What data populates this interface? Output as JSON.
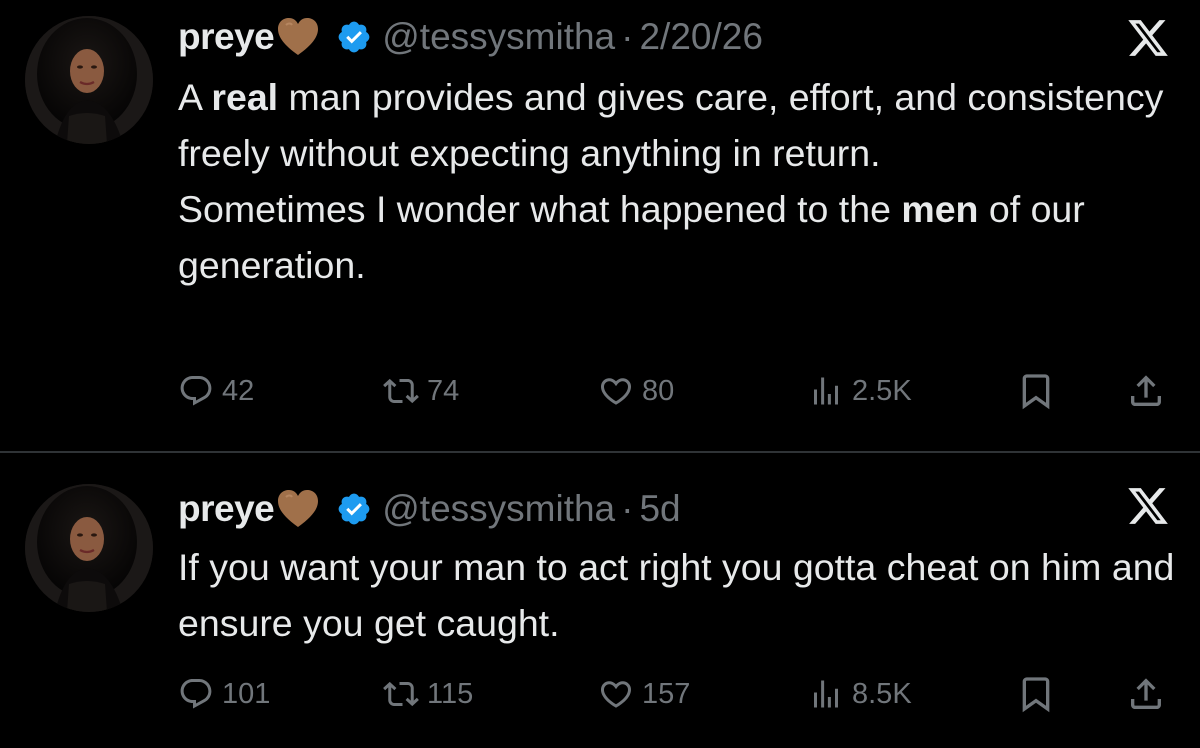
{
  "tweets": [
    {
      "display_name": "preye",
      "name_emoji": "brown-heart",
      "verified": true,
      "handle": "@tessysmitha",
      "separator": "·",
      "time": "2/20/26",
      "text_segments": [
        {
          "line": 1,
          "parts": [
            {
              "text": "A ",
              "bold": false
            },
            {
              "text": "real",
              "bold": true
            },
            {
              "text": " man provides and gives care, effort, and consistency freely without expecting anything in return.",
              "bold": false
            }
          ]
        },
        {
          "line": 2,
          "parts": [
            {
              "text": "Sometimes I wonder what happened to the ",
              "bold": false
            },
            {
              "text": "men",
              "bold": true
            },
            {
              "text": " of our generation.",
              "bold": false
            }
          ]
        }
      ],
      "stats": {
        "replies": "42",
        "reposts": "74",
        "likes": "80",
        "views": "2.5K"
      }
    },
    {
      "display_name": "preye",
      "name_emoji": "brown-heart",
      "verified": true,
      "handle": "@tessysmitha",
      "separator": "·",
      "time": "5d",
      "text": "If you want your man to act right you gotta cheat on him and ensure you get caught.",
      "stats": {
        "replies": "101",
        "reposts": "115",
        "likes": "157",
        "views": "8.5K"
      }
    }
  ],
  "icons": {
    "reply": "reply-icon",
    "repost": "repost-icon",
    "like": "heart-icon",
    "views": "views-icon",
    "bookmark": "bookmark-icon",
    "share": "share-icon",
    "platform": "x-logo-icon",
    "verified": "verified-badge-icon"
  },
  "colors": {
    "background": "#000000",
    "text_primary": "#e7e9ea",
    "text_secondary": "#71767b",
    "verified_blue": "#1d9bf0",
    "heart_brown": "#a0704a",
    "divider": "#2f3336"
  }
}
